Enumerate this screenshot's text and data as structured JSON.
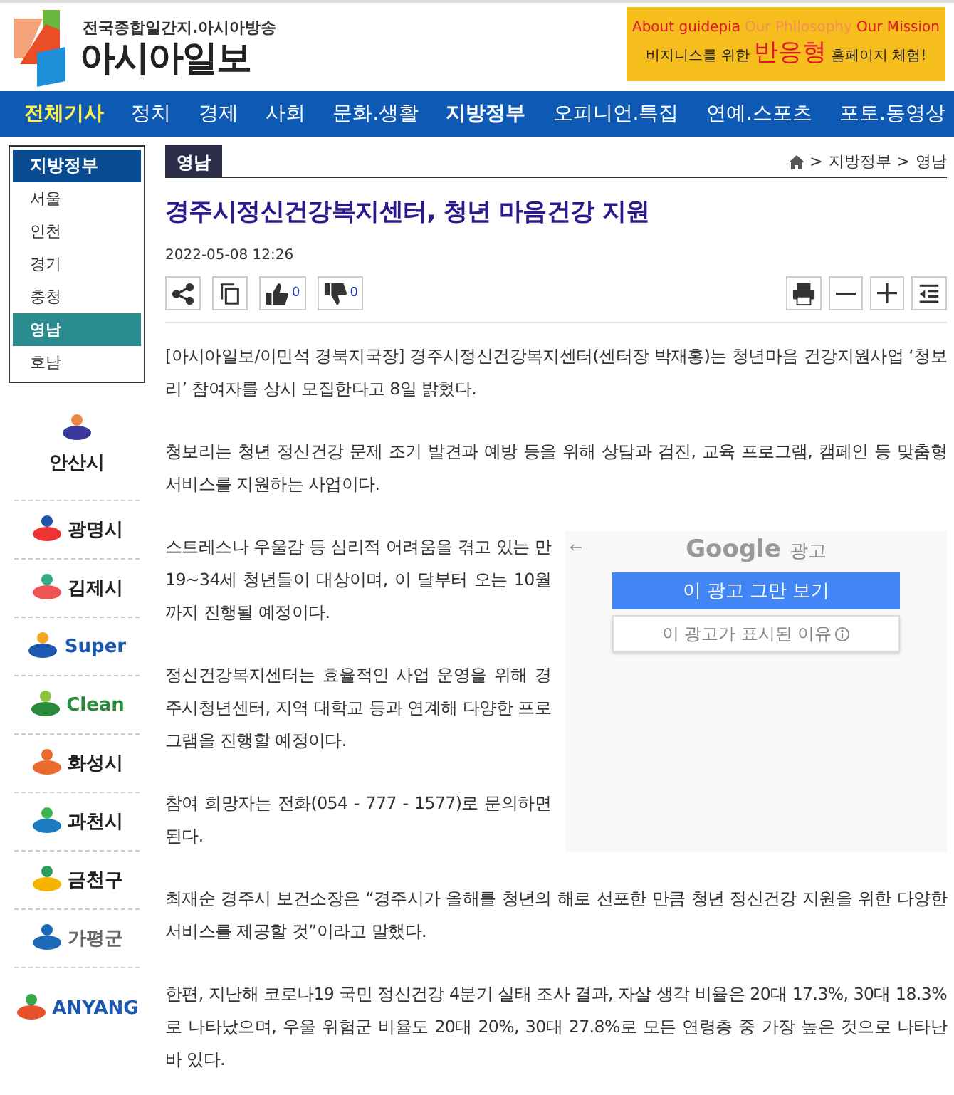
{
  "header": {
    "tagline": "전국종합일간지.아시아방송",
    "logo_text": "아시아일보",
    "banner": {
      "links": [
        {
          "text": "About guidepia",
          "kind": "strong"
        },
        {
          "text": "Our Philosophy",
          "kind": "soft"
        },
        {
          "text": "Our Mission",
          "kind": "strong"
        }
      ],
      "slogan": [
        {
          "text": "비지니스를 위한",
          "kind": "plain"
        },
        {
          "text": "반응형",
          "kind": "big"
        },
        {
          "text": "홈페이지 체험!",
          "kind": "plain"
        }
      ]
    }
  },
  "nav": [
    {
      "label": "전체기사",
      "highlighted": true,
      "bold": true
    },
    {
      "label": "정치",
      "highlighted": false,
      "bold": false
    },
    {
      "label": "경제",
      "highlighted": false,
      "bold": false
    },
    {
      "label": "사회",
      "highlighted": false,
      "bold": false
    },
    {
      "label": "문화.생활",
      "highlighted": false,
      "bold": false
    },
    {
      "label": "지방정부",
      "highlighted": false,
      "bold": true
    },
    {
      "label": "오피니언.특집",
      "highlighted": false,
      "bold": false
    },
    {
      "label": "연예.스포츠",
      "highlighted": false,
      "bold": false
    },
    {
      "label": "포토.동영상",
      "highlighted": false,
      "bold": false
    }
  ],
  "sidebar": {
    "title": "지방정부",
    "items": [
      {
        "label": "서울",
        "selected": false
      },
      {
        "label": "인천",
        "selected": false
      },
      {
        "label": "경기",
        "selected": false
      },
      {
        "label": "충청",
        "selected": false
      },
      {
        "label": "영남",
        "selected": true
      },
      {
        "label": "호남",
        "selected": false
      }
    ],
    "logos": [
      {
        "label": "안산시",
        "kind": "ansan"
      },
      {
        "label": "광명시",
        "kind": "gwangmyeong"
      },
      {
        "label": "김제시",
        "kind": "gimje"
      },
      {
        "label": "Super",
        "kind": "pyeongtaek"
      },
      {
        "label": "Clean",
        "kind": "gwangju"
      },
      {
        "label": "화성시",
        "kind": "hwaseong"
      },
      {
        "label": "과천시",
        "kind": "gwacheon"
      },
      {
        "label": "금천구",
        "kind": "geumcheon"
      },
      {
        "label": "가평군",
        "kind": "gapyeong"
      },
      {
        "label": "ANYANG",
        "kind": "anyang"
      }
    ]
  },
  "article": {
    "section_tab": "영남",
    "breadcrumb": [
      {
        "separator": ">",
        "label": "지방정부"
      },
      {
        "separator": ">",
        "label": "영남"
      }
    ],
    "title": "경주시정신건강복지센터, 청년 마음건강 지원",
    "date": "2022-05-08 12:26",
    "likes": "0",
    "dislikes": "0",
    "paragraphs": [
      "[아시아일보/이민석 경북지국장] 경주시정신건강복지센터(센터장 박재홍)는 청년마음 건강지원사업 ‘청보리’ 참여자를 상시 모집한다고 8일 밝혔다.",
      "청보리는 청년 정신건강 문제 조기 발견과 예방 등을 위해 상담과 검진, 교육 프로그램, 캠페인 등 맞춤형 서비스를 지원하는 사업이다.",
      "스트레스나 우울감 등 심리적 어려움을 겪고 있는 만 19~34세 청년들이 대상이며, 이 달부터 오는 10월까지 진행될 예정이다.",
      "정신건강복지센터는 효율적인 사업 운영을 위해 경주시청년센터, 지역 대학교 등과 연계해 다양한 프로그램을 진행할 예정이다.",
      "참여 희망자는 전화(054 - 777 - 1577)로 문의하면 된다.",
      "최재순 경주시 보건소장은 “경주시가 올해를 청년의 해로 선포한 만큼 청년 정신건강 지원을 위한 다양한 서비스를 제공할 것”이라고 말했다.",
      "한편, 지난해 코로나19 국민 정신건강 4분기 실태 조사 결과, 자살 생각 비율은 20대 17.3%, 30대 18.3%로 나타났으며, 우울 위험군 비율도 20대 20%, 30대 27.8%로 모든 연령층 중 가장 높은 것으로 나타난 바 있다."
    ],
    "ad": {
      "back": "←",
      "brand": "Google",
      "label": "광고",
      "stop_button": "이 광고 그만 보기",
      "why_button": "이 광고가 표시된 이유"
    }
  }
}
